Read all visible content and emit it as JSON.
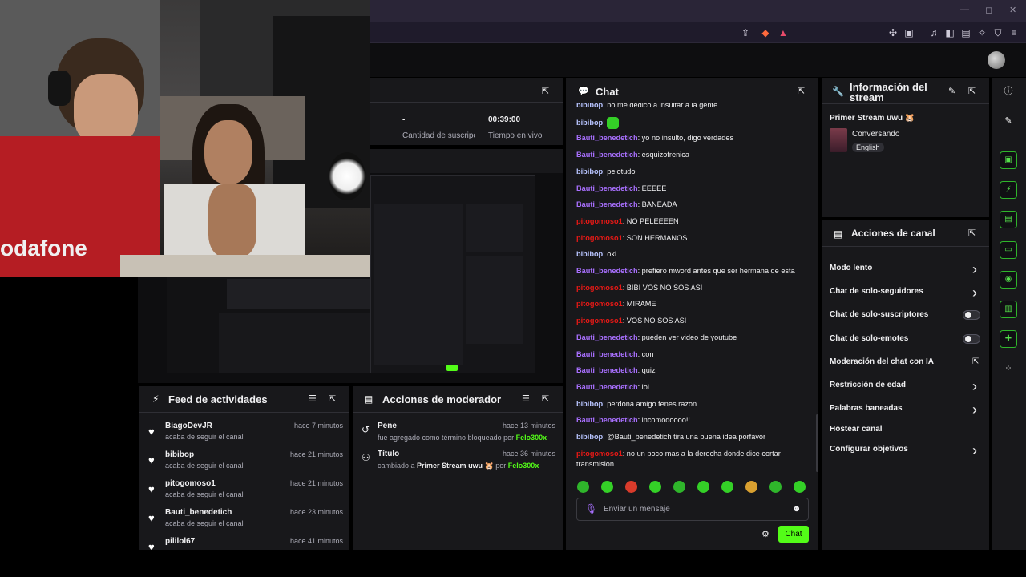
{
  "window": {
    "minimize": "—",
    "maximize": "◻",
    "close": "✕"
  },
  "stats": {
    "stat1_value": "-",
    "stat1_label": "Cantidad de suscripciones",
    "stat2_value": "00:39:00",
    "stat2_label": "Tiempo en vivo"
  },
  "chat": {
    "title": "Chat",
    "messages": [
      {
        "user": "bibibop",
        "text": ": no me dedico a insultar a la gente",
        "color": "blue"
      },
      {
        "user": "bibibop",
        "text": ": ",
        "color": "blue",
        "emote": true
      },
      {
        "user": "Bauti_benedetich",
        "text": ": yo no insulto, digo verdades",
        "color": "purple"
      },
      {
        "user": "Bauti_benedetich",
        "text": ": esquizofrenica",
        "color": "purple"
      },
      {
        "user": "bibibop",
        "text": ": pelotudo",
        "color": "blue"
      },
      {
        "user": "Bauti_benedetich",
        "text": ": EEEEE",
        "color": "purple"
      },
      {
        "user": "Bauti_benedetich",
        "text": ": BANEADA",
        "color": "purple"
      },
      {
        "user": "pitogomoso1",
        "text": ": NO PELEEEEN",
        "color": "red"
      },
      {
        "user": "pitogomoso1",
        "text": ": SON HERMANOS",
        "color": "red"
      },
      {
        "user": "bibibop",
        "text": ": oki",
        "color": "blue"
      },
      {
        "user": "Bauti_benedetich",
        "text": ": prefiero mword antes que ser hermana de esta",
        "color": "purple"
      },
      {
        "user": "pitogomoso1",
        "text": ": BIBI VOS NO SOS ASI",
        "color": "red"
      },
      {
        "user": "pitogomoso1",
        "text": ": MIRAME",
        "color": "red"
      },
      {
        "user": "pitogomoso1",
        "text": ": VOS NO SOS ASI",
        "color": "red"
      },
      {
        "user": "Bauti_benedetich",
        "text": ": pueden ver video de youtube",
        "color": "purple"
      },
      {
        "user": "Bauti_benedetich",
        "text": ": con",
        "color": "purple"
      },
      {
        "user": "Bauti_benedetich",
        "text": ": quiz",
        "color": "purple"
      },
      {
        "user": "Bauti_benedetich",
        "text": ": lol",
        "color": "purple"
      },
      {
        "user": "bibibop",
        "text": ": perdona amigo tenes razon",
        "color": "blue"
      },
      {
        "user": "Bauti_benedetich",
        "text": ": incomodoooo!!",
        "color": "purple"
      },
      {
        "user": "bibibop",
        "text": ": @Bauti_benedetich tira una buena idea porfavor",
        "color": "blue"
      },
      {
        "user": "pitogomoso1",
        "text": ": no un poco mas a la derecha donde dice cortar transmision",
        "color": "red"
      }
    ],
    "input_placeholder": "Enviar un mensaje",
    "send_label": "Chat"
  },
  "stream_info": {
    "title": "Información del stream",
    "stream_title": "Primer Stream uwu 🐹",
    "category": "Conversando",
    "language": "English"
  },
  "channel_actions": {
    "title": "Acciones de canal",
    "items": [
      {
        "label": "Modo lento",
        "control": "chevron"
      },
      {
        "label": "Chat de solo-seguidores",
        "control": "chevron"
      },
      {
        "label": "Chat de solo-suscriptores",
        "control": "toggle"
      },
      {
        "label": "Chat de solo-emotes",
        "control": "toggle"
      },
      {
        "label": "Moderación del chat con IA",
        "control": "external"
      },
      {
        "label": "Restricción de edad",
        "control": "chevron"
      },
      {
        "label": "Palabras baneadas",
        "control": "chevron"
      },
      {
        "label": "Hostear canal",
        "control": "none"
      },
      {
        "label": "Configurar objetivos",
        "control": "chevron"
      }
    ]
  },
  "activity_feed": {
    "title": "Feed de actividades",
    "items": [
      {
        "name": "BiagoDevJR",
        "action": "acaba de seguir el canal",
        "time": "hace 7 minutos"
      },
      {
        "name": "bibibop",
        "action": "acaba de seguir el canal",
        "time": "hace 21 minutos"
      },
      {
        "name": "pitogomoso1",
        "action": "acaba de seguir el canal",
        "time": "hace 21 minutos"
      },
      {
        "name": "Bauti_benedetich",
        "action": "acaba de seguir el canal",
        "time": "hace 23 minutos"
      },
      {
        "name": "pililol67",
        "action": "",
        "time": "hace 41 minutos"
      }
    ]
  },
  "mod_actions": {
    "title": "Acciones de moderador",
    "items": [
      {
        "title": "Pene",
        "desc_prefix": "fue agregado como término bloqueado por ",
        "actor": "Felo300x",
        "time": "hace 13 minutos"
      },
      {
        "title": "Título",
        "desc_prefix": "cambiado a ",
        "highlight": "Primer Stream uwu 🐹",
        "desc_mid": " por ",
        "actor": "Felo300x",
        "time": "hace 36 minutos"
      }
    ]
  },
  "colors": {
    "accent_green": "#53fc18",
    "panel_bg": "#18181b",
    "purple_user": "#a970ff",
    "red_user": "#e91916"
  }
}
